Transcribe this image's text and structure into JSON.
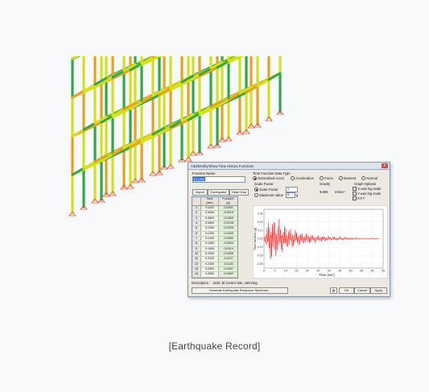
{
  "caption": "[Earthquake Record]",
  "dialog": {
    "title": "Add/Modify/Show Time History Functions",
    "close_glyph": "✕",
    "function_name_label": "Function Name",
    "function_name_value": "ELCEN",
    "import_label": "Import",
    "earthquake_label": "Earthquake",
    "graph_label": "Heat Grap",
    "table_headers": [
      {
        "label": "",
        "unit": ""
      },
      {
        "label": "Time",
        "unit": "(sec)"
      },
      {
        "label": "Function",
        "unit": "(g)"
      }
    ],
    "rows": [
      [
        "1",
        "0.0200",
        "-0.0001"
      ],
      [
        "2",
        "0.0400",
        "-0.0019"
      ],
      [
        "3",
        "0.0600",
        "-0.0069"
      ],
      [
        "4",
        "0.0800",
        "-0.0138"
      ],
      [
        "5",
        "0.1000",
        "-0.0028"
      ],
      [
        "6",
        "0.1200",
        "-0.0039"
      ],
      [
        "7",
        "0.1400",
        "-0.0084"
      ],
      [
        "8",
        "0.1600",
        "-0.0064"
      ],
      [
        "9",
        "0.1800",
        "-0.0014"
      ],
      [
        "10",
        "0.2000",
        "-0.0058"
      ],
      [
        "11",
        "0.2200",
        "-0.1137"
      ],
      [
        "12",
        "0.2400",
        "-0.1126"
      ],
      [
        "13",
        "0.2600",
        "-0.0067"
      ],
      [
        "14",
        "0.2800",
        "-0.0062"
      ]
    ],
    "data_type_label": "Time Function Data Type",
    "data_types": [
      {
        "label": "Normalized Accel.",
        "selected": true
      },
      {
        "label": "Acceleration",
        "selected": false
      },
      {
        "label": "Force",
        "selected": false
      },
      {
        "label": "Moment",
        "selected": false
      },
      {
        "label": "Normal",
        "selected": false
      }
    ],
    "scale_factor_label": "Scale Factor",
    "scale_options": [
      {
        "label": "Scale Factor",
        "selected": true
      },
      {
        "label": "Maximum Value",
        "selected": false
      }
    ],
    "scale_value": "1",
    "max_value": "0",
    "max_unit": "g",
    "gravity_label": "Gravity",
    "gravity_value": "9.806",
    "gravity_unit": "m/sec²",
    "graph_options_label": "Graph Options",
    "graph_options": [
      {
        "label": "X-axis log scale",
        "checked": false
      },
      {
        "label": "Y-axis log scale",
        "checked": false
      },
      {
        "label": "F.F.T",
        "checked": false
      }
    ],
    "description_label": "Description :",
    "description_value": "1940, El Centro Site, 180 Deg",
    "spectrum_button": "Generate Earthquake Response Spectrum...",
    "ok_label": "OK",
    "cancel_label": "Cancel",
    "apply_label": "Apply"
  },
  "colors": {
    "beam_low": "#2fa84a",
    "beam_mid": "#d4e020",
    "beam_high": "#e8a020",
    "beam_peak": "#d84a2a",
    "support": "#e24a4a",
    "signal": "#ff1a1a"
  },
  "chart_data": {
    "type": "line",
    "title": "",
    "xlabel": "Time (sec)",
    "ylabel": "Time function (g)",
    "xlim": [
      0,
      55
    ],
    "ylim": [
      -0.35,
      0.35
    ],
    "xticks": [
      "0",
      "5",
      "10",
      "15",
      "20",
      "25",
      "30",
      "35",
      "40",
      "45",
      "50",
      "55"
    ],
    "yticks": [
      "0.30",
      "0.20",
      "0.10",
      "0.00",
      "-0.10",
      "-0.20",
      "-0.30"
    ],
    "grid": true,
    "series": [
      {
        "name": "",
        "x": [
          0,
          0.5,
          1,
          1.5,
          2,
          2.5,
          3,
          3.5,
          4,
          4.5,
          5,
          5.5,
          6,
          6.5,
          7,
          7.5,
          8,
          8.5,
          9,
          9.5,
          10,
          10.5,
          11,
          11.5,
          12,
          12.5,
          13,
          13.5,
          14,
          14.5,
          15,
          15.5,
          16,
          16.5,
          17,
          17.5,
          18,
          18.5,
          19,
          19.5,
          20,
          20.5,
          21,
          21.5,
          22,
          22.5,
          23,
          23.5,
          24,
          24.5,
          25,
          25.5,
          26,
          26.5,
          27,
          27.5,
          28,
          28.5,
          29,
          29.5,
          30,
          30.5,
          31,
          31.5,
          32,
          32.5,
          33,
          33.5,
          34,
          34.5,
          35,
          35.5,
          36,
          36.5,
          37,
          37.5,
          38,
          38.5,
          39,
          39.5,
          40,
          40.5,
          41,
          41.5,
          42,
          42.5,
          43,
          43.5,
          44,
          44.5,
          45,
          45.5,
          46,
          46.5,
          47,
          47.5,
          48,
          48.5,
          49,
          49.5,
          50,
          50.5,
          51,
          51.5,
          52,
          52.5,
          53
        ],
        "values": [
          0,
          0.05,
          -0.12,
          0.18,
          -0.22,
          0.25,
          -0.3,
          0.32,
          -0.28,
          0.22,
          -0.31,
          0.27,
          -0.2,
          0.24,
          -0.26,
          0.18,
          -0.19,
          0.21,
          -0.15,
          0.17,
          -0.18,
          0.14,
          -0.12,
          0.16,
          -0.13,
          0.11,
          -0.14,
          0.1,
          -0.09,
          0.12,
          -0.1,
          0.08,
          -0.09,
          0.1,
          -0.07,
          0.09,
          -0.08,
          0.06,
          -0.07,
          0.08,
          -0.06,
          0.07,
          -0.05,
          0.06,
          -0.06,
          0.05,
          -0.04,
          0.06,
          -0.05,
          0.04,
          -0.05,
          0.04,
          -0.03,
          0.05,
          -0.04,
          0.03,
          -0.04,
          0.03,
          -0.03,
          0.04,
          -0.03,
          0.03,
          -0.03,
          0.02,
          -0.03,
          0.03,
          -0.02,
          0.03,
          -0.02,
          0.02,
          -0.03,
          0.02,
          -0.02,
          0.02,
          -0.02,
          0.02,
          -0.02,
          0.01,
          -0.02,
          0.02,
          -0.01,
          0.02,
          -0.02,
          0.01,
          -0.01,
          0.02,
          -0.01,
          0.01,
          -0.01,
          0.01,
          -0.01,
          0.01,
          -0.01,
          0.01,
          -0.01,
          0.01,
          -0.01,
          0.01,
          -0.01,
          0.01,
          -0.01,
          0.01,
          -0.01,
          0.01,
          -0.01,
          0.01,
          0
        ]
      }
    ]
  }
}
